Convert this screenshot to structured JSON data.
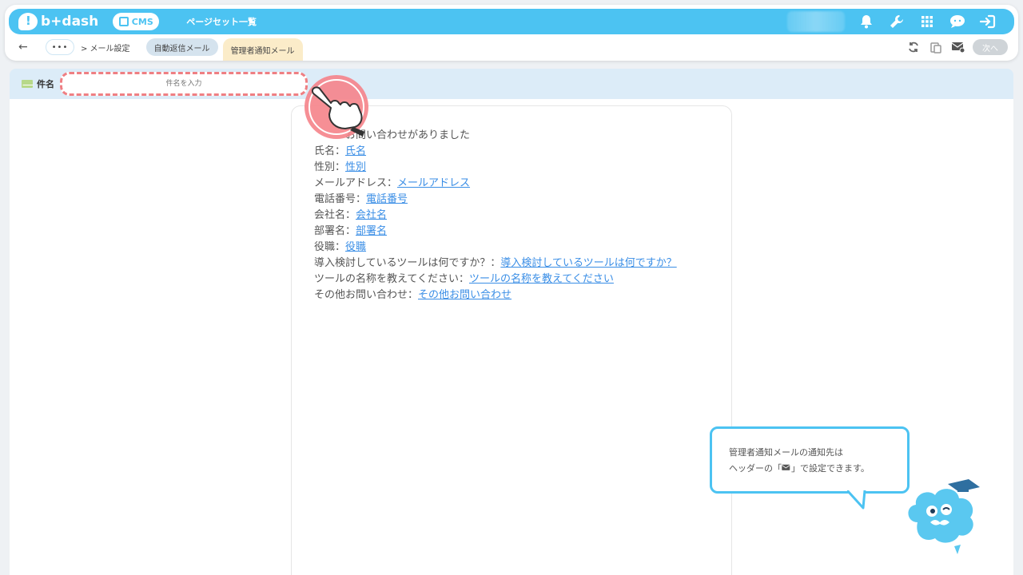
{
  "header": {
    "logo_text": "b+dash",
    "cms_label": "CMS",
    "page_list_label": "ページセット一覧"
  },
  "subheader": {
    "back_symbol": "←",
    "more_symbol": "•••",
    "breadcrumb": "> メール設定",
    "tabs": [
      {
        "label": "自動返信メール",
        "active": false
      },
      {
        "label": "管理者通知メール",
        "active": true
      }
    ],
    "next_label": "次へ"
  },
  "subject": {
    "label": "件名",
    "placeholder": "件名を入力"
  },
  "mail_body": {
    "first_line": "お問い合わせがありました",
    "lines": [
      {
        "label": "氏名：",
        "placeholder": "氏名"
      },
      {
        "label": "性別：",
        "placeholder": "性別"
      },
      {
        "label": "メールアドレス：",
        "placeholder": "メールアドレス"
      },
      {
        "label": "電話番号：",
        "placeholder": "電話番号"
      },
      {
        "label": "会社名：",
        "placeholder": "会社名"
      },
      {
        "label": "部署名：",
        "placeholder": "部署名"
      },
      {
        "label": "役職：",
        "placeholder": "役職"
      },
      {
        "label": "導入検討しているツールは何ですか？：",
        "placeholder": "導入検討しているツールは何ですか？"
      },
      {
        "label": "ツールの名称を教えてください：",
        "placeholder": "ツールの名称を教えてください"
      },
      {
        "label": "その他お問い合わせ：",
        "placeholder": "その他お問い合わせ"
      }
    ]
  },
  "tooltip": {
    "line1": "管理者通知メールの通知先は",
    "line2": "ヘッダーの「",
    "line2_icon": "mail-settings-icon",
    "line2_end": "」で設定できます。"
  },
  "colors": {
    "header_blue": "#4cc3f2",
    "active_tab": "#fbecc9",
    "link_blue": "#3a8ee6",
    "highlight_red": "#ef7f83"
  }
}
